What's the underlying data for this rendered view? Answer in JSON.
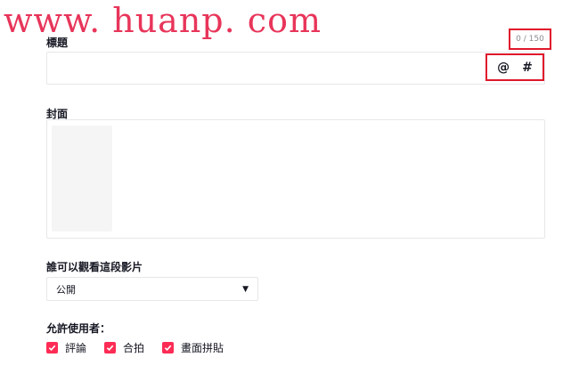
{
  "watermark": "www. huanp. com",
  "title_field": {
    "label": "標題",
    "counter": "0 / 150",
    "mention_symbol": "@",
    "hashtag_symbol": "#"
  },
  "cover": {
    "label": "封面"
  },
  "privacy": {
    "label": "誰可以觀看這段影片",
    "selected": "公開"
  },
  "allow": {
    "label": "允許使用者：",
    "options": [
      {
        "label": "評論",
        "checked": true
      },
      {
        "label": "合拍",
        "checked": true
      },
      {
        "label": "畫面拼貼",
        "checked": true
      }
    ]
  },
  "colors": {
    "accent": "#fe2c55",
    "highlight": "#e0182b",
    "watermark": "#e8355a"
  }
}
